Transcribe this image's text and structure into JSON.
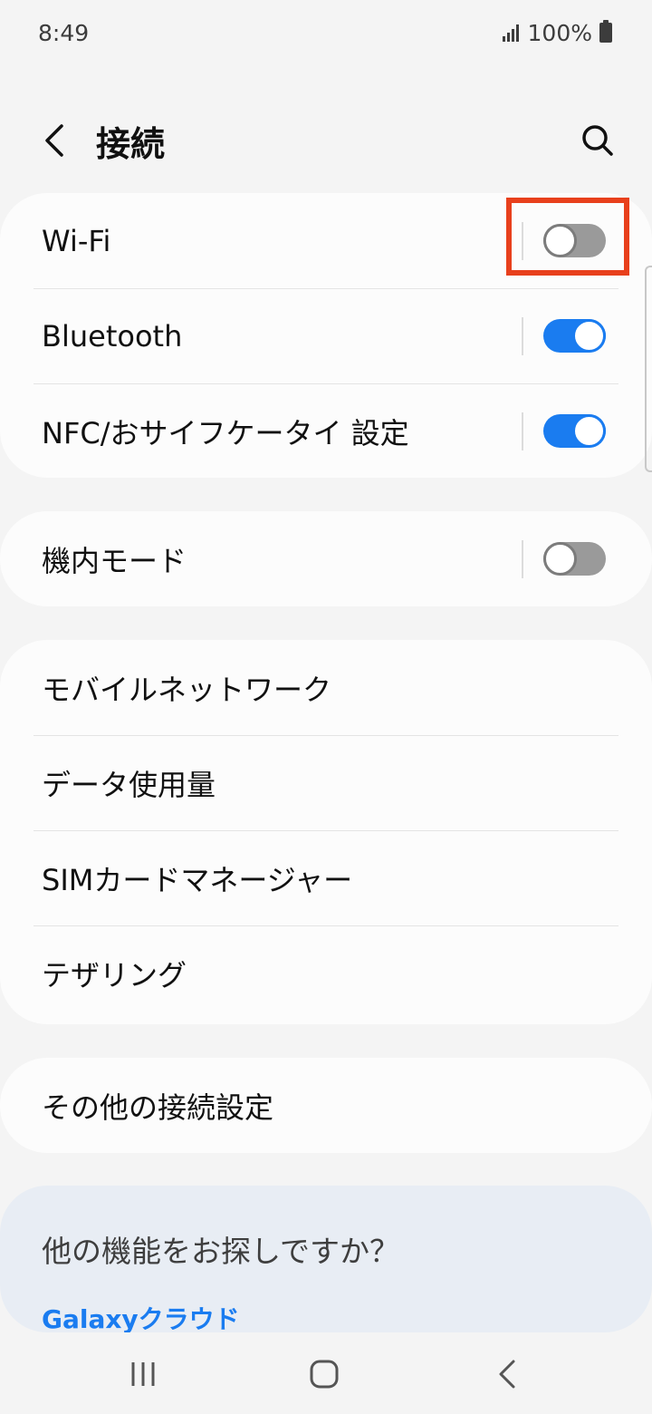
{
  "status_bar": {
    "time": "8:49",
    "battery": "100%"
  },
  "header": {
    "title": "接続"
  },
  "group1": {
    "items": [
      {
        "label": "Wi-Fi",
        "toggle": "off"
      },
      {
        "label": "Bluetooth",
        "toggle": "on"
      },
      {
        "label": "NFC/おサイフケータイ 設定",
        "toggle": "on"
      }
    ]
  },
  "group2": {
    "items": [
      {
        "label": "機内モード",
        "toggle": "off"
      }
    ]
  },
  "group3": {
    "items": [
      {
        "label": "モバイルネットワーク"
      },
      {
        "label": "データ使用量"
      },
      {
        "label": "SIMカードマネージャー"
      },
      {
        "label": "テザリング"
      }
    ]
  },
  "group4": {
    "items": [
      {
        "label": "その他の接続設定"
      }
    ]
  },
  "suggestion": {
    "title": "他の機能をお探しですか？",
    "link": "Galaxyクラウド"
  },
  "icons": {
    "back": "chevron-left-icon",
    "search": "search-icon",
    "recents": "recents-icon",
    "home": "home-icon",
    "nav_back": "nav-back-icon"
  },
  "colors": {
    "accent": "#1a7cf0",
    "highlight": "#e8401c",
    "toggle_off": "#9a9a9a"
  }
}
